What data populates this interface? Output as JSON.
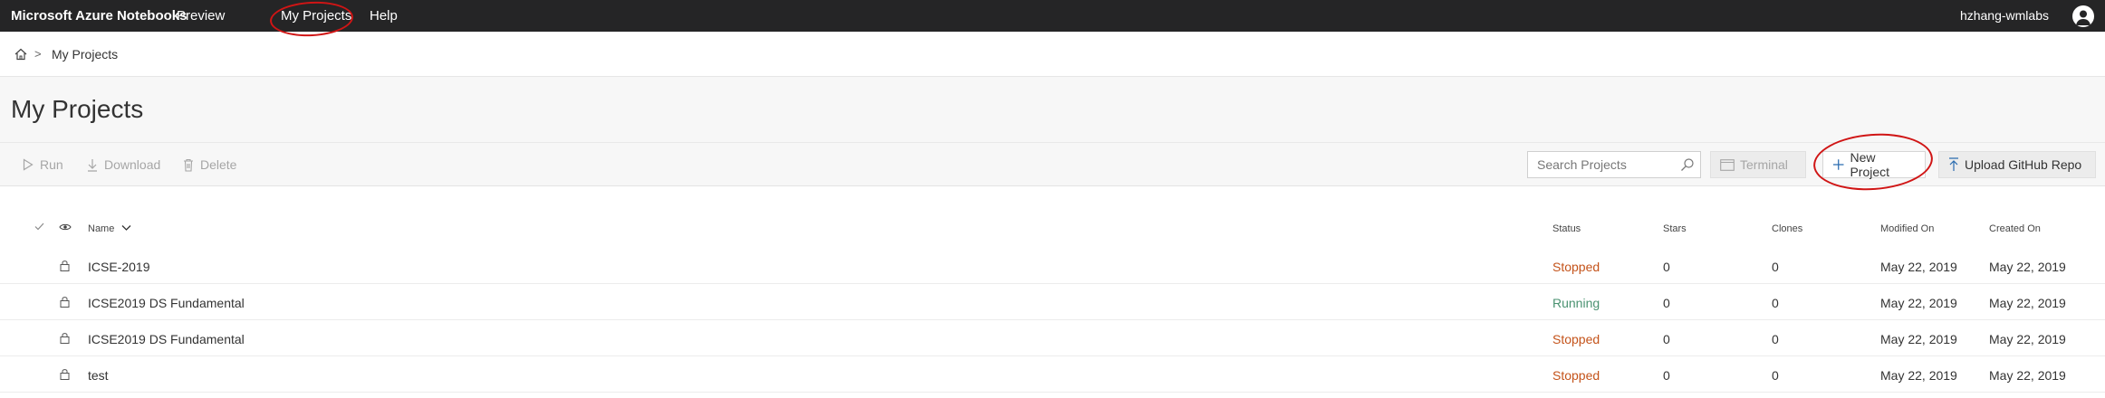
{
  "topbar": {
    "brand": "Microsoft Azure Notebooks",
    "nav": [
      {
        "label": "Preview"
      },
      {
        "label": "My Projects"
      },
      {
        "label": "Help"
      }
    ],
    "user_name": "hzhang-wmlabs"
  },
  "breadcrumb": {
    "separator": ">",
    "current": "My Projects"
  },
  "page": {
    "title": "My Projects"
  },
  "toolbar": {
    "run_label": "Run",
    "download_label": "Download",
    "delete_label": "Delete",
    "search_placeholder": "Search Projects",
    "terminal_label": "Terminal",
    "new_project_label": "New Project",
    "upload_label": "Upload GitHub Repo"
  },
  "table": {
    "columns": {
      "name": "Name",
      "status": "Status",
      "stars": "Stars",
      "clones": "Clones",
      "modified": "Modified On",
      "created": "Created On"
    },
    "rows": [
      {
        "name": "ICSE-2019",
        "status": "Stopped",
        "stars": "0",
        "clones": "0",
        "modified": "May 22, 2019",
        "created": "May 22, 2019"
      },
      {
        "name": "ICSE2019 DS Fundamental",
        "status": "Running",
        "stars": "0",
        "clones": "0",
        "modified": "May 22, 2019",
        "created": "May 22, 2019"
      },
      {
        "name": "ICSE2019 DS Fundamental",
        "status": "Stopped",
        "stars": "0",
        "clones": "0",
        "modified": "May 22, 2019",
        "created": "May 22, 2019"
      },
      {
        "name": "test",
        "status": "Stopped",
        "stars": "0",
        "clones": "0",
        "modified": "May 22, 2019",
        "created": "May 22, 2019"
      }
    ]
  },
  "colors": {
    "topbar_bg": "#252526",
    "status_stopped": "#c4531a",
    "status_running": "#4a9271",
    "annotation": "#d01515"
  }
}
